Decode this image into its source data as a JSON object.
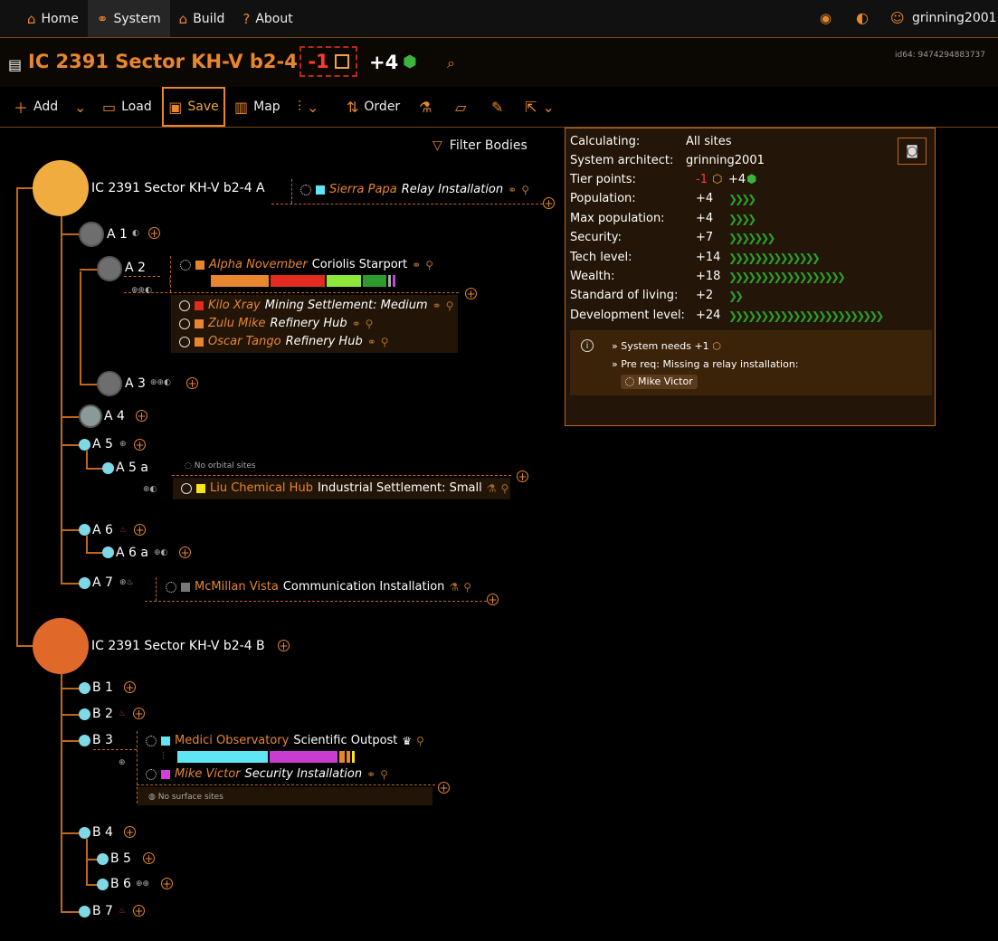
{
  "nav": {
    "home": "Home",
    "system": "System",
    "build": "Build",
    "about": "About",
    "user": "grinning2001"
  },
  "header": {
    "title": "IC 2391 Sector KH-V b2-4",
    "tier_neg": "-1",
    "tier_pos": "+4",
    "id64": "id64: 9474294883737"
  },
  "toolbar": {
    "add": "Add",
    "load": "Load",
    "save": "Save",
    "map": "Map",
    "order": "Order"
  },
  "filter": "Filter Bodies",
  "panel": {
    "calculating_label": "Calculating:",
    "calculating_value": "All sites",
    "architect_label": "System architect:",
    "architect_value": "grinning2001",
    "tier_label": "Tier points:",
    "tier_neg": "-1",
    "tier_pos": "+4",
    "population_label": "Population:",
    "population_value": "+4",
    "maxpop_label": "Max population:",
    "maxpop_value": "+4",
    "security_label": "Security:",
    "security_value": "+7",
    "tech_label": "Tech level:",
    "tech_value": "+14",
    "wealth_label": "Wealth:",
    "wealth_value": "+18",
    "sol_label": "Standard of living:",
    "sol_value": "+2",
    "dev_label": "Development level:",
    "dev_value": "+24",
    "note1": "» System needs +1",
    "note2": "» Pre req: Missing a relay installation:",
    "note_chip": "Mike Victor"
  },
  "bodies": {
    "starA": "IC 2391 Sector KH-V b2-4 A",
    "a1": "A 1",
    "a2": "A 2",
    "a3": "A 3",
    "a4": "A 4",
    "a5": "A 5",
    "a5a": "A 5 a",
    "a6": "A 6",
    "a6a": "A 6 a",
    "a7": "A 7",
    "starB": "IC 2391 Sector KH-V b2-4 B",
    "b1": "B 1",
    "b2": "B 2",
    "b3": "B 3",
    "b4": "B 4",
    "b5": "B 5",
    "b6": "B 6",
    "b7": "B 7"
  },
  "sites": {
    "sierra_name": "Sierra Papa",
    "sierra_type": "Relay Installation",
    "alpha_name": "Alpha November",
    "alpha_type": "Coriolis Starport",
    "kilo_name": "Kilo Xray",
    "kilo_type": "Mining Settlement: Medium",
    "zulu_name": "Zulu Mike",
    "zulu_type": "Refinery Hub",
    "oscar_name": "Oscar Tango",
    "oscar_type": "Refinery Hub",
    "no_orbital": "No orbital sites",
    "liu_name": "Liu Chemical Hub",
    "liu_type": "Industrial Settlement: Small",
    "mcmillan_name": "McMillan Vista",
    "mcmillan_type": "Communication Installation",
    "medici_name": "Medici Observatory",
    "medici_type": "Scientific Outpost",
    "mike_name": "Mike Victor",
    "mike_type": "Security Installation",
    "no_surface": "No surface sites"
  },
  "colors": {
    "accent": "#e8862e",
    "negative": "#ff3b2a",
    "positive": "#3cb33c"
  },
  "chevrons": {
    "population": 4,
    "maxpop": 4,
    "security": 7,
    "tech": 14,
    "wealth": 18,
    "sol": 2,
    "dev": 24
  }
}
